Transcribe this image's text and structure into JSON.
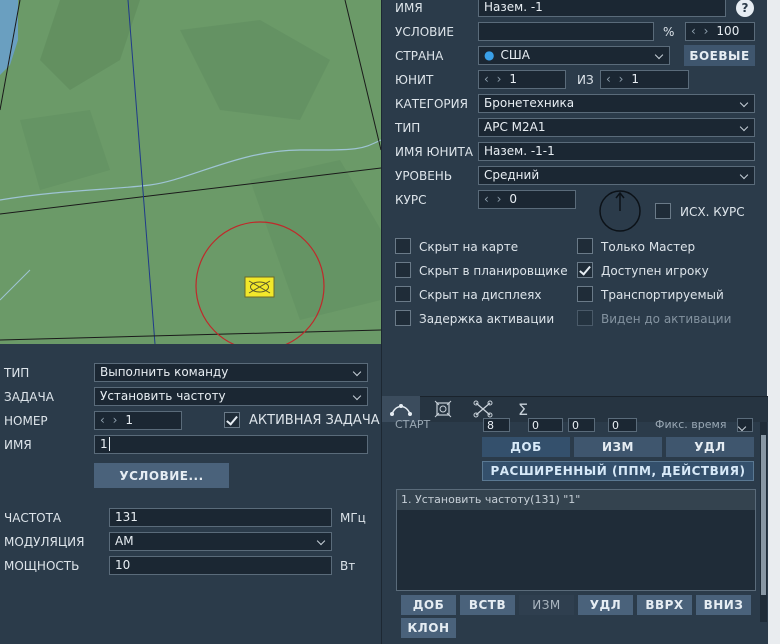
{
  "map": {},
  "command": {
    "type_label": "ТИП",
    "type_value": "Выполнить команду",
    "task_label": "ЗАДАЧА",
    "task_value": "Установить частоту",
    "number_label": "НОМЕР",
    "number_value": "1",
    "active_task_label": "АКТИВНАЯ ЗАДАЧА",
    "name_label": "ИМЯ",
    "name_value": "1",
    "condition_button": "УСЛОВИЕ...",
    "frequency_label": "ЧАСТОТА",
    "frequency_value": "131",
    "frequency_unit": "МГц",
    "modulation_label": "МОДУЛЯЦИЯ",
    "modulation_value": "AM",
    "power_label": "МОЩНОСТЬ",
    "power_value": "10",
    "power_unit": "Вт"
  },
  "unit": {
    "name_label": "ИМЯ",
    "name_value": "Назем. -1",
    "help_icon": "?",
    "condition_label": "УСЛОВИЕ",
    "condition_pct": "%",
    "condition_value": "100",
    "country_label": "СТРАНА",
    "country_value": "США",
    "combat_button": "БОЕВЫЕ",
    "unit_label": "ЮНИТ",
    "unit_value": "1",
    "of_label": "ИЗ",
    "of_value": "1",
    "category_label": "КАТЕГОРИЯ",
    "category_value": "Бронетехника",
    "type_label": "ТИП",
    "type_value": "APC M2A1",
    "unit_name_label": "ИМЯ ЮНИТА",
    "unit_name_value": "Назем. -1-1",
    "level_label": "УРОВЕНЬ",
    "level_value": "Средний",
    "heading_label": "КУРС",
    "heading_value": "0",
    "init_heading_label": "ИСХ. КУРС",
    "checks": {
      "hidden_map": "Скрыт на карте",
      "hidden_planner": "Скрыт в планировщике",
      "hidden_displays": "Скрыт на дисплеях",
      "activation_delay": "Задержка активации",
      "master_only": "Только Мастер",
      "player_available": "Доступен игроку",
      "transportable": "Транспортируемый",
      "visible_before": "Виден до активации"
    }
  },
  "route": {
    "start_label": "СТАРТ",
    "start_h": "8",
    "start_m": "0",
    "start_s": "0",
    "start_f": "0",
    "fixed_time": "Фикс. время",
    "btn_add": "ДОБ",
    "btn_edit": "ИЗМ",
    "btn_del": "УДЛ",
    "advanced_button": "РАСШИРЕННЫЙ (ППМ, ДЕЙСТВИЯ)",
    "list_item": "1. Установить частоту(131) \"1\"",
    "b_add": "ДОБ",
    "b_insert": "ВСТВ",
    "b_edit": "ИЗМ",
    "b_del": "УДЛ",
    "b_up": "ВВРХ",
    "b_down": "ВНИЗ",
    "b_clone": "КЛОН"
  }
}
